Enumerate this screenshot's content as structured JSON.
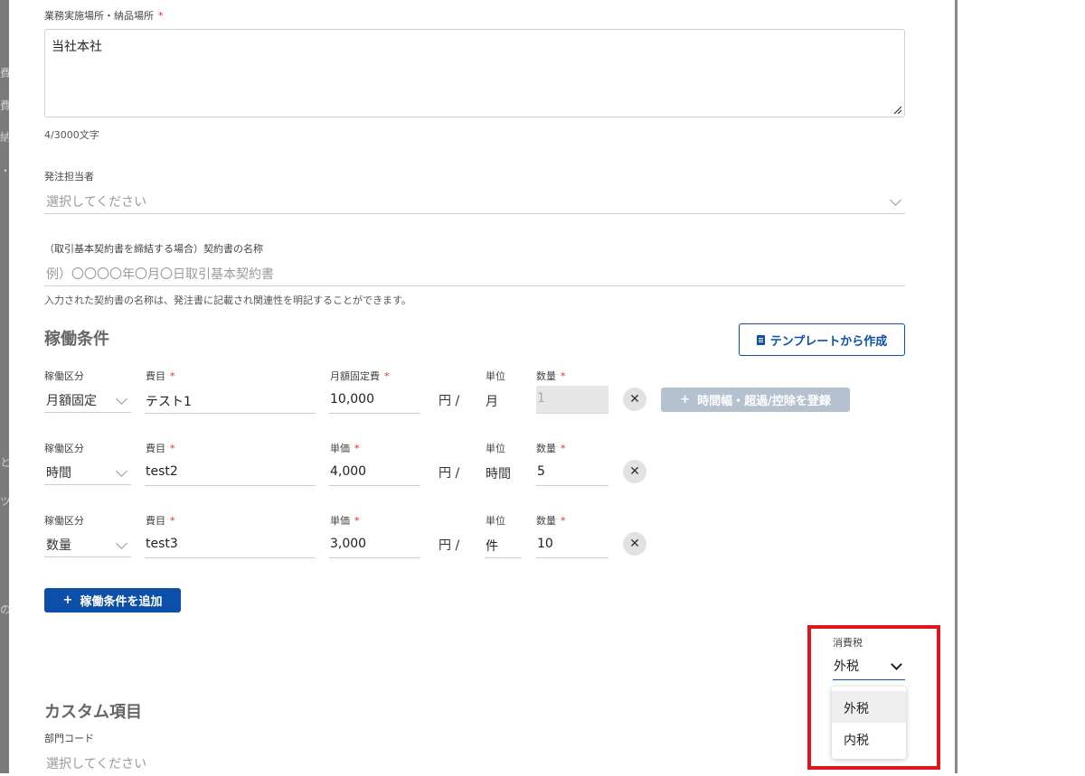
{
  "work_location": {
    "label": "業務実施場所・納品場所",
    "required_mark": "*",
    "value": "当社本社",
    "char_count": "4/3000文字"
  },
  "order_person": {
    "label": "発注担当者",
    "placeholder": "選択してください"
  },
  "contract_name": {
    "label": "（取引基本契約書を締結する場合）契約書の名称",
    "placeholder": "例）〇〇〇〇年〇月〇日取引基本契約書",
    "hint": "入力された契約書の名称は、発注書に記載され関連性を明記することができます。"
  },
  "operating_conditions": {
    "title": "稼働条件",
    "template_button": "テンプレートから作成",
    "yen_label": "円 /",
    "remove_glyph": "✕",
    "register_button": "時間幅・超過/控除を登録",
    "add_button": "稼働条件を追加",
    "plus": "+",
    "rows": [
      {
        "type_label": "稼働区分",
        "type_value": "月額固定",
        "item_label": "費目",
        "item_value": "テスト1",
        "price_label": "月額固定費",
        "price_value": "10,000",
        "unit_label": "単位",
        "unit_value": "月",
        "qty_label": "数量",
        "qty_value": "1"
      },
      {
        "type_label": "稼働区分",
        "type_value": "時間",
        "item_label": "費目",
        "item_value": "test2",
        "price_label": "単価",
        "price_value": "4,000",
        "unit_label": "単位",
        "unit_value": "時間",
        "qty_label": "数量",
        "qty_value": "5"
      },
      {
        "type_label": "稼働区分",
        "type_value": "数量",
        "item_label": "費目",
        "item_value": "test3",
        "price_label": "単価",
        "price_value": "3,000",
        "unit_label": "単位",
        "unit_value": "件",
        "qty_label": "数量",
        "qty_value": "10"
      }
    ]
  },
  "consumption_tax": {
    "label": "消費税",
    "value": "外税",
    "options": [
      "外税",
      "内税"
    ],
    "highlight_color": "#e0151f"
  },
  "custom_items": {
    "title": "カスタム項目",
    "dept_label": "部門コード",
    "dept_placeholder": "選択してください"
  },
  "colors": {
    "primary": "#0b4fa8",
    "required": "#e02b2b",
    "disabled_button": "#b6c1d0"
  },
  "background_glimpses": [
    "費",
    "費",
    "納",
    "・",
    "と",
    "ツ",
    "の"
  ]
}
